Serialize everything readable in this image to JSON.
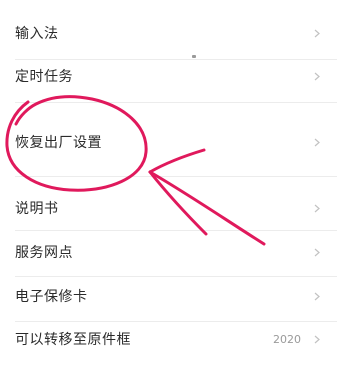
{
  "settings": {
    "items": [
      {
        "label": "输入法"
      },
      {
        "label": "定时任务"
      },
      {
        "label": "恢复出厂设置"
      },
      {
        "label": "说明书"
      },
      {
        "label": "服务网点"
      },
      {
        "label": "电子保修卡"
      },
      {
        "label": "可以转移至原件框",
        "value": "2020"
      }
    ]
  },
  "annotation": {
    "color": "#e0195c"
  },
  "icons": {
    "row_chevron": "chevron-right-icon"
  }
}
